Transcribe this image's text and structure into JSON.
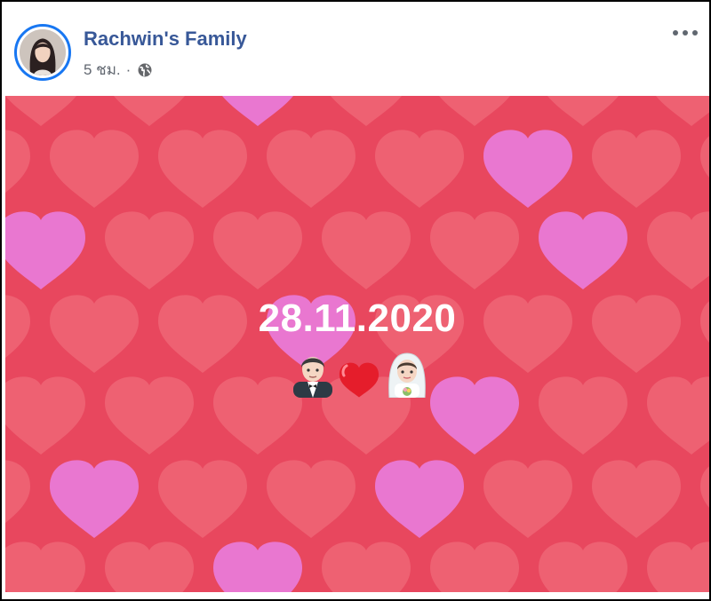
{
  "post": {
    "author_name": "Rachwin's Family",
    "timestamp": "5 ชม.",
    "separator": "·",
    "audience_icon": "globe-icon",
    "more_icon": "more-options-icon"
  },
  "image": {
    "date_text": "28.11.2020",
    "emojis": [
      "groom-emoji",
      "red-heart-emoji",
      "bride-emoji"
    ],
    "background_color": "#e8475e",
    "heart_colors": {
      "salmon": "#f06a7a",
      "pink": "#e97ad6"
    }
  },
  "colors": {
    "author_link": "#385898",
    "meta_text": "#616770",
    "avatar_ring": "#1877f2"
  }
}
